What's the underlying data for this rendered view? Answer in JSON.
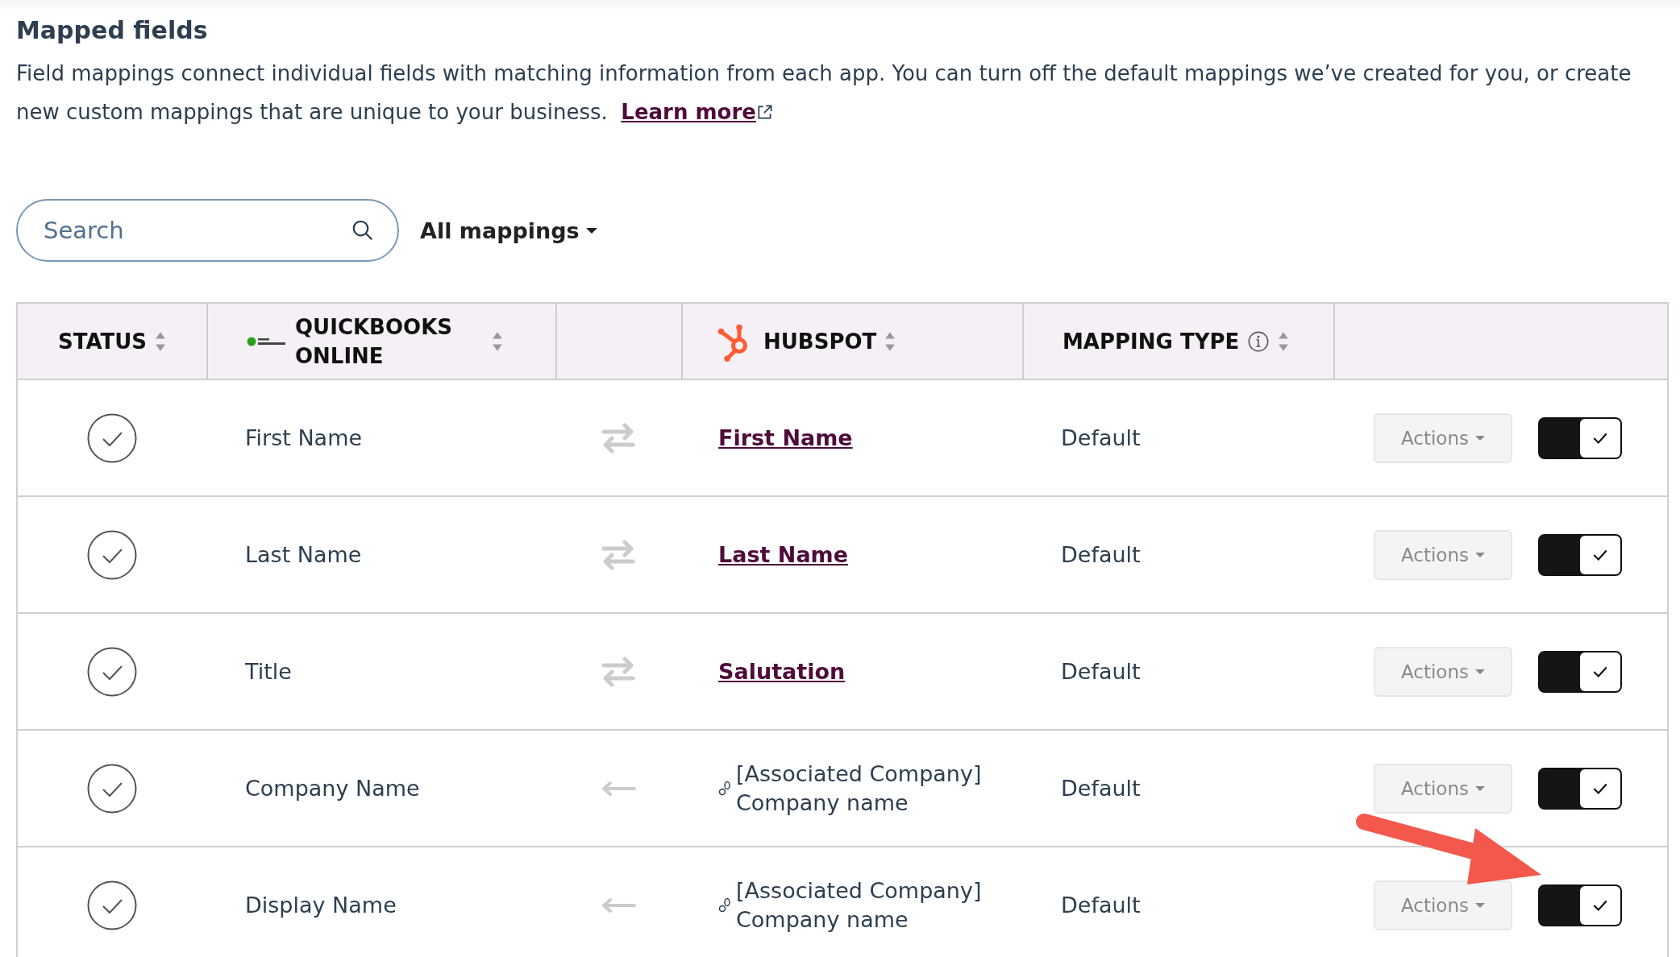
{
  "section": {
    "title": "Mapped fields",
    "description": "Field mappings connect individual fields with matching information from each app. You can turn off the default mappings we’ve created for you, or create new custom mappings that are unique to your business.",
    "learn_more": "Learn more"
  },
  "search": {
    "placeholder": "Search"
  },
  "filter": {
    "label": "All mappings"
  },
  "table": {
    "columns": [
      {
        "label": "STATUS",
        "kind": "plain"
      },
      {
        "label": "QUICKBOOKS ONLINE",
        "kind": "quickbooks"
      },
      {
        "kind": "empty"
      },
      {
        "label": "HUBSPOT",
        "kind": "hubspot"
      },
      {
        "label": "MAPPING TYPE",
        "kind": "info"
      }
    ],
    "rows": [
      {
        "quickbooks": "First Name",
        "kind": "two_way",
        "hubspot": {
          "kind": "link",
          "text": "First Name"
        },
        "mapping_type": "Default",
        "action": "Actions",
        "on": true
      },
      {
        "quickbooks": "Last Name",
        "kind": "two_way",
        "hubspot": {
          "kind": "link",
          "text": "Last Name"
        },
        "mapping_type": "Default",
        "action": "Actions",
        "on": true
      },
      {
        "quickbooks": "Title",
        "kind": "two_way",
        "hubspot": {
          "kind": "link",
          "text": "Salutation"
        },
        "mapping_type": "Default",
        "action": "Actions",
        "on": true
      },
      {
        "quickbooks": "Company Name",
        "kind": "one_way",
        "hubspot": {
          "kind": "associated",
          "text": "[Associated Company] Company name"
        },
        "mapping_type": "Default",
        "action": "Actions",
        "on": true
      },
      {
        "quickbooks": "Display Name",
        "kind": "one_way",
        "hubspot": {
          "kind": "associated",
          "text": "[Associated Company] Company name"
        },
        "mapping_type": "Default",
        "action": "Actions",
        "on": true
      }
    ]
  }
}
